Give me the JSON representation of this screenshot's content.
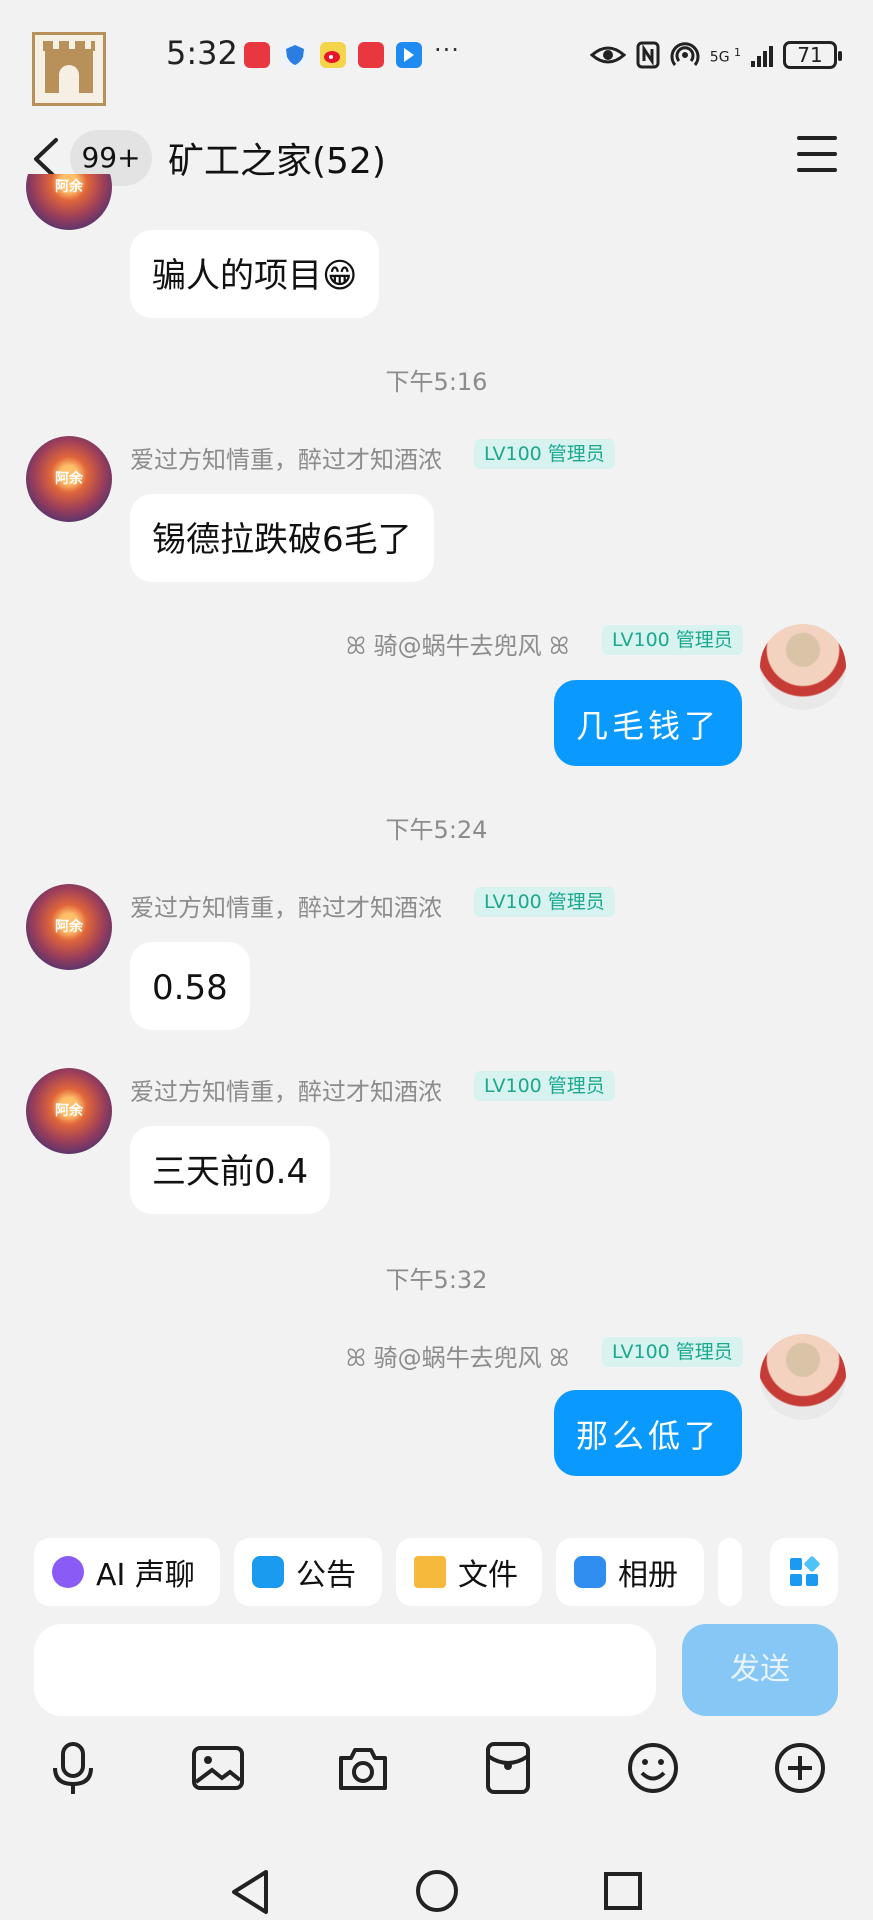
{
  "status_bar": {
    "time": "5:32",
    "signal_label": "5G",
    "sim_index": "1",
    "battery": "71",
    "more_glyph": "···"
  },
  "header": {
    "unread_badge": "99+",
    "title": "矿工之家(52)"
  },
  "messages": [
    {
      "side": "left",
      "text": "骗人的项目😁"
    },
    {
      "timestamp": "下午5:16"
    },
    {
      "side": "left",
      "sender": "爱过方知情重，醉过才知酒浓",
      "badge": "LV100 管理员",
      "text": "锡德拉跌破6毛了"
    },
    {
      "side": "right",
      "sender": "ꕤ 骑@蜗牛去兜风 ꕤ",
      "badge": "LV100 管理员",
      "text": "几毛钱了"
    },
    {
      "timestamp": "下午5:24"
    },
    {
      "side": "left",
      "sender": "爱过方知情重，醉过才知酒浓",
      "badge": "LV100 管理员",
      "text": "0.58"
    },
    {
      "side": "left",
      "sender": "爱过方知情重，醉过才知酒浓",
      "badge": "LV100 管理员",
      "text": "三天前0.4"
    },
    {
      "timestamp": "下午5:32"
    },
    {
      "side": "right",
      "sender": "ꕤ 骑@蜗牛去兜风 ꕤ",
      "badge": "LV100 管理员",
      "text": "那么低了"
    }
  ],
  "toolbar": {
    "chips": [
      "AI 声聊",
      "公告",
      "文件",
      "相册"
    ]
  },
  "composer": {
    "send_label": "发送"
  },
  "colors": {
    "self_bubble": "#0a99ff",
    "admin_badge_bg": "#d8f3ef",
    "admin_badge_text": "#1aa88e"
  }
}
